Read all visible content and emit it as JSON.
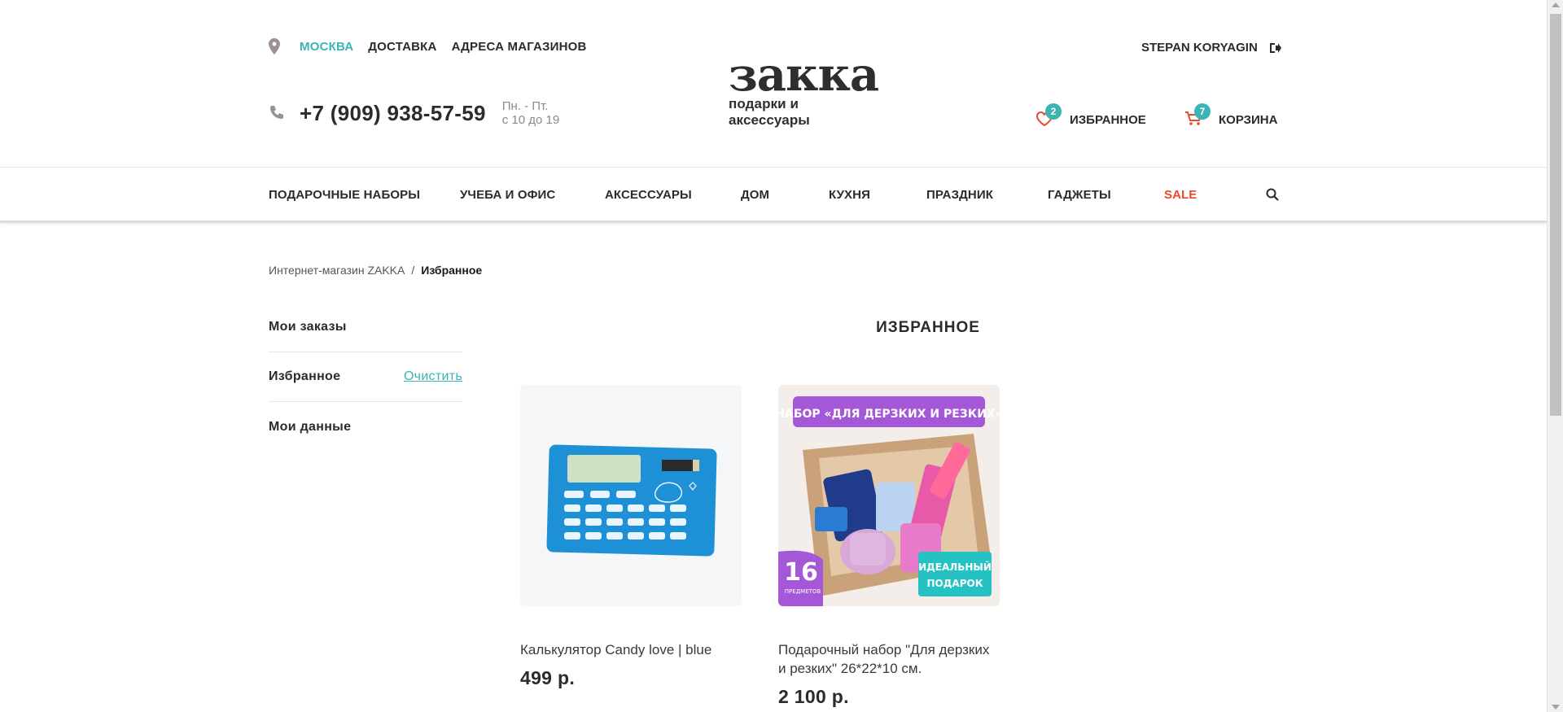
{
  "header": {
    "city": "МОСКВА",
    "nav_links": [
      "ДОСТАВКА",
      "АДРЕСА МАГАЗИНОВ"
    ],
    "phone": "+7 (909) 938-57-59",
    "hours_line1": "Пн. - Пт.",
    "hours_line2": "с 10 до 19",
    "logo_word": "закка",
    "logo_tagline": "подарки и аксессуары",
    "user_name": "STEPAN KORYAGIN",
    "favorites_label": "ИЗБРАННОЕ",
    "favorites_count": "2",
    "cart_label": "КОРЗИНА",
    "cart_count": "7",
    "accent_color": "#3bb4b4",
    "sale_color": "#e84a2e"
  },
  "catnav": {
    "items": [
      "ПОДАРОЧНЫЕ НАБОРЫ",
      "УЧЕБА И ОФИС",
      "АКСЕССУАРЫ",
      "ДОМ",
      "КУХНЯ",
      "ПРАЗДНИК",
      "ГАДЖЕТЫ",
      "SALE"
    ]
  },
  "breadcrumb": {
    "home": "Интернет-магазин ZAKKA",
    "separator": "/",
    "current": "Избранное"
  },
  "sidebar": {
    "items": [
      {
        "label": "Мои заказы"
      },
      {
        "label": "Избранное",
        "action": "Очистить"
      },
      {
        "label": "Мои данные"
      }
    ]
  },
  "main": {
    "title": "ИЗБРАННОЕ",
    "products": [
      {
        "title": "Калькулятор Candy love | blue",
        "price": "499 р."
      },
      {
        "title": "Подарочный набор \"Для дерзких и резких\" 26*22*10 см.",
        "price": "2 100 р.",
        "banner_text": "НАБОР «ДЛЯ ДЕРЗКИХ И РЕЗКИХ»",
        "badge_number": "16",
        "badge_sub": "ПРЕДМЕТОВ",
        "promo_line1": "ИДЕАЛЬНЫЙ",
        "promo_line2": "ПОДАРОК"
      }
    ]
  }
}
